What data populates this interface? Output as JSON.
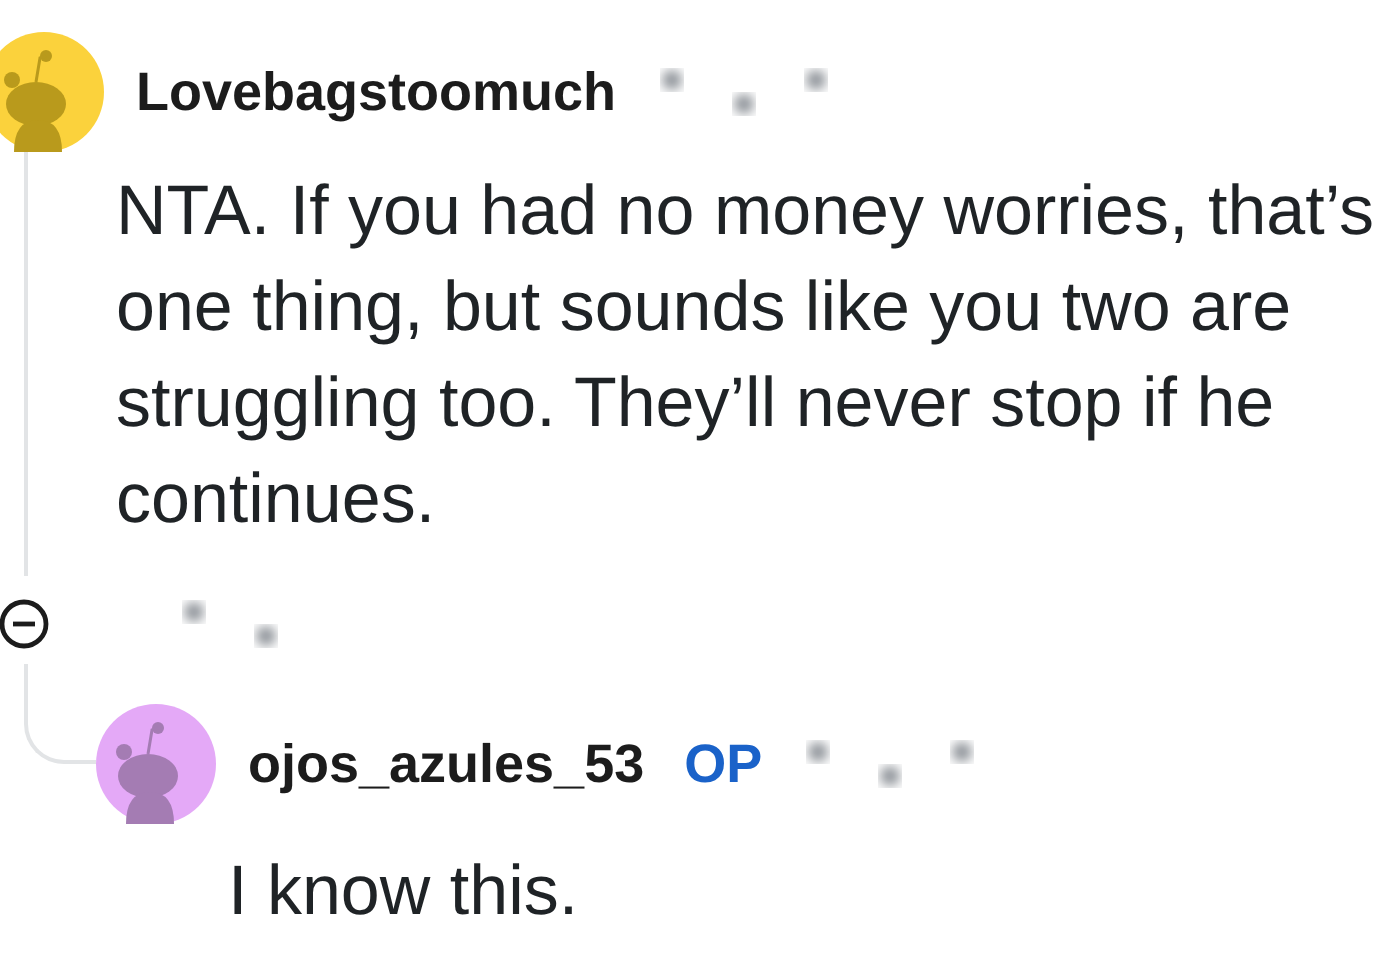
{
  "comments": [
    {
      "username": "Lovebagstoomuch",
      "body": "NTA. If you had no money worries, that’s one thing, but sounds like you two are struggling too. They’ll never stop if he continues."
    },
    {
      "username": "ojos_azules_53",
      "badge": "OP",
      "body": "I know this."
    }
  ]
}
